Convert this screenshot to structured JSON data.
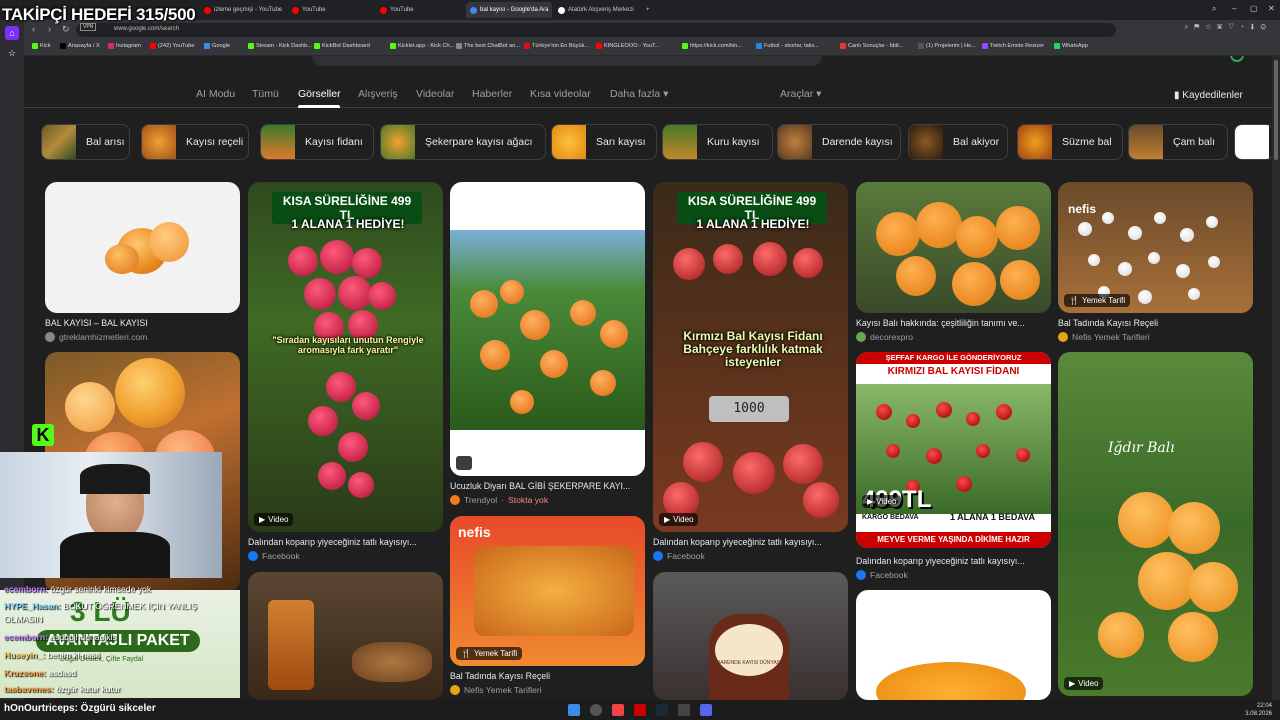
{
  "stream": {
    "follow_goal": "TAKİPÇİ HEDEFİ 315/500",
    "bottom_label": "hOnOurtriceps: Özgürü sikceler"
  },
  "browser": {
    "tabs": [
      {
        "label": "izleme geçmişi - YouTube",
        "color": "#ff0000"
      },
      {
        "label": "YouTube",
        "color": "#ff0000"
      },
      {
        "label": "YouTube",
        "color": "#ff0000"
      },
      {
        "label": "bal kayısı - Google'da Ara",
        "color": "#4285f4",
        "active": true
      },
      {
        "label": "Atatürk Alışveriş Merkezi",
        "color": "#ffffff"
      }
    ],
    "new_tab": "+",
    "url": "www.google.com/search",
    "vpn": "VPN",
    "bookmarks": [
      {
        "label": "Kick",
        "color": "#53fc18"
      },
      {
        "label": "Anasayfa / X",
        "color": "#000000"
      },
      {
        "label": "Instagram",
        "color": "#d62976"
      },
      {
        "label": "(242) YouTube",
        "color": "#ff0000"
      },
      {
        "label": "Google",
        "color": "#4285f4"
      },
      {
        "label": "Stream - Kick Dashb...",
        "color": "#53fc18"
      },
      {
        "label": "KickBot Dashboard",
        "color": "#53fc18"
      },
      {
        "label": "Kicklet.app - Kick Ch...",
        "color": "#53fc18"
      },
      {
        "label": "The best ChatBot an...",
        "color": "#888888"
      },
      {
        "label": "Türkiye'nin En Büyük...",
        "color": "#e30a17"
      },
      {
        "label": "KINGLEOOO - YouT...",
        "color": "#ff0000"
      },
      {
        "label": "https://kick.com/kin...",
        "color": "#53fc18"
      },
      {
        "label": "Futbol - skorlar, takv...",
        "color": "#1e88e5"
      },
      {
        "label": "Canlı Sonuçlar - İddi...",
        "color": "#e53935"
      },
      {
        "label": "(1) Projelerim | He...",
        "color": "#555555"
      },
      {
        "label": "Twitch Emote Resizer",
        "color": "#9146ff"
      },
      {
        "label": "WhatsApp",
        "color": "#25d366"
      }
    ]
  },
  "google": {
    "tabs": [
      "AI Modu",
      "Tümü",
      "Görseller",
      "Alışveriş",
      "Videolar",
      "Haberler",
      "Kısa videolar",
      "Daha fazla ▾"
    ],
    "active_tab": "Görseller",
    "tools": "Araçlar ▾",
    "saved": "Kaydedilenler",
    "chips": [
      "Bal arısı",
      "Kayısı reçeli",
      "Kayısı fidanı",
      "Şekerpare kayısı ağacı",
      "Sarı kayısı",
      "Kuru kayısı",
      "Darende kayısı",
      "Bal akiyor",
      "Süzme bal",
      "Çam balı"
    ],
    "results": [
      {
        "caption": "BAL KAYISI – BAL KAYISI",
        "source": "gtreklamhizmetleri.com",
        "source_color": "#888888"
      },
      {
        "caption": "Dalından koparıp yiyeceğiniz tatlı kayısıyı...",
        "source": "Facebook",
        "source_color": "#1877f2",
        "badge": "Video"
      },
      {
        "caption": "Ucuzluk Diyarı BAL GİBİ ŞEKERPARE KAYI...",
        "source": "Trendyol",
        "source_color": "#f27a1a",
        "stock": "Stokta yok"
      },
      {
        "caption": "Dalından koparıp yiyeceğiniz tatlı kayısıyı...",
        "source": "Facebook",
        "source_color": "#1877f2",
        "badge": "Video"
      },
      {
        "caption": "Kayısı Balı hakkında: çeşitliliğin tanımı ve...",
        "source": "decorexpro",
        "source_color": "#6aa84f"
      },
      {
        "caption": "Bal Tadında Kayısı Reçeli",
        "source": "Nefis Yemek Tarifleri",
        "source_color": "#e8a317",
        "badge": "Yemek Tarifi"
      },
      {
        "caption": "Dalından koparıp yiyeceğiniz tatlı kayısıyı...",
        "source": "Facebook",
        "source_color": "#1877f2",
        "badge": "Video"
      },
      {
        "caption": "Bal Tadında Kayısı Reçeli",
        "source": "Nefis Yemek Tarifleri",
        "source_color": "#e8a317",
        "badge": "Yemek Tarifi"
      },
      {
        "badge": "Video"
      }
    ],
    "overlays": {
      "promo_top": "KISA SÜRELİĞİNE 499 TL",
      "promo_gift": "1 ALANA 1 HEDİYE!",
      "promo_quote": "\"Sıradan kayısıları unutun Rengiyle aromasıyla fark yaratır\"",
      "promo_fidan": "Kırmızı Bal Kayısı Fidanı Bahçeye farklılık katmak isteyenler",
      "scale": "1000",
      "cargo": "ŞEFFAF KARGO İLE GÖNDERİYORUZ",
      "fidan_title": "KIRMIZI BAL KAYISI FİDANI",
      "price": "499TL",
      "free_cargo": "KARGO BEDAVA",
      "one_plus_one": "1 ALANA 1 BEDAVA",
      "ready": "MEYVE VERME YAŞINDA DİKİME HAZIR",
      "igdir": "Iğdır Balı",
      "nefis": "nefis",
      "jar_label": "DARENDE KAYISI DÜNYASI"
    }
  },
  "chat": {
    "messages": [
      {
        "user": "ecemborn:",
        "text": "özgür seninki kimsede yok",
        "color": "#c58af9"
      },
      {
        "user": "HYPE_Hasan:",
        "text": "BOKUT ÖĞRENMEK İÇİN YANLIŞ",
        "color": "#7fd4ff"
      },
      {
        "user": "",
        "text": "OLMASIN",
        "color": "#ffffff"
      },
      {
        "user": "ecemborn:",
        "text": "asdqbjhdqhadjkls",
        "color": "#c58af9"
      },
      {
        "user": "Huseyin_:",
        "text": "benim ki nasıl",
        "color": "#ffd166"
      },
      {
        "user": "Kruzsone:",
        "text": "asdasd",
        "color": "#ff9f43"
      },
      {
        "user": "tasbavenes:",
        "text": "özgür kutur kutur",
        "color": "#ff9f43"
      }
    ]
  },
  "ad": {
    "big": "3 LÜ",
    "pill": "AVANTAJLI PAKET",
    "sub": "Doğal Destek, Çifte Faydal"
  },
  "taskbar": {
    "time": "22:04",
    "date": "3.08.2026"
  }
}
